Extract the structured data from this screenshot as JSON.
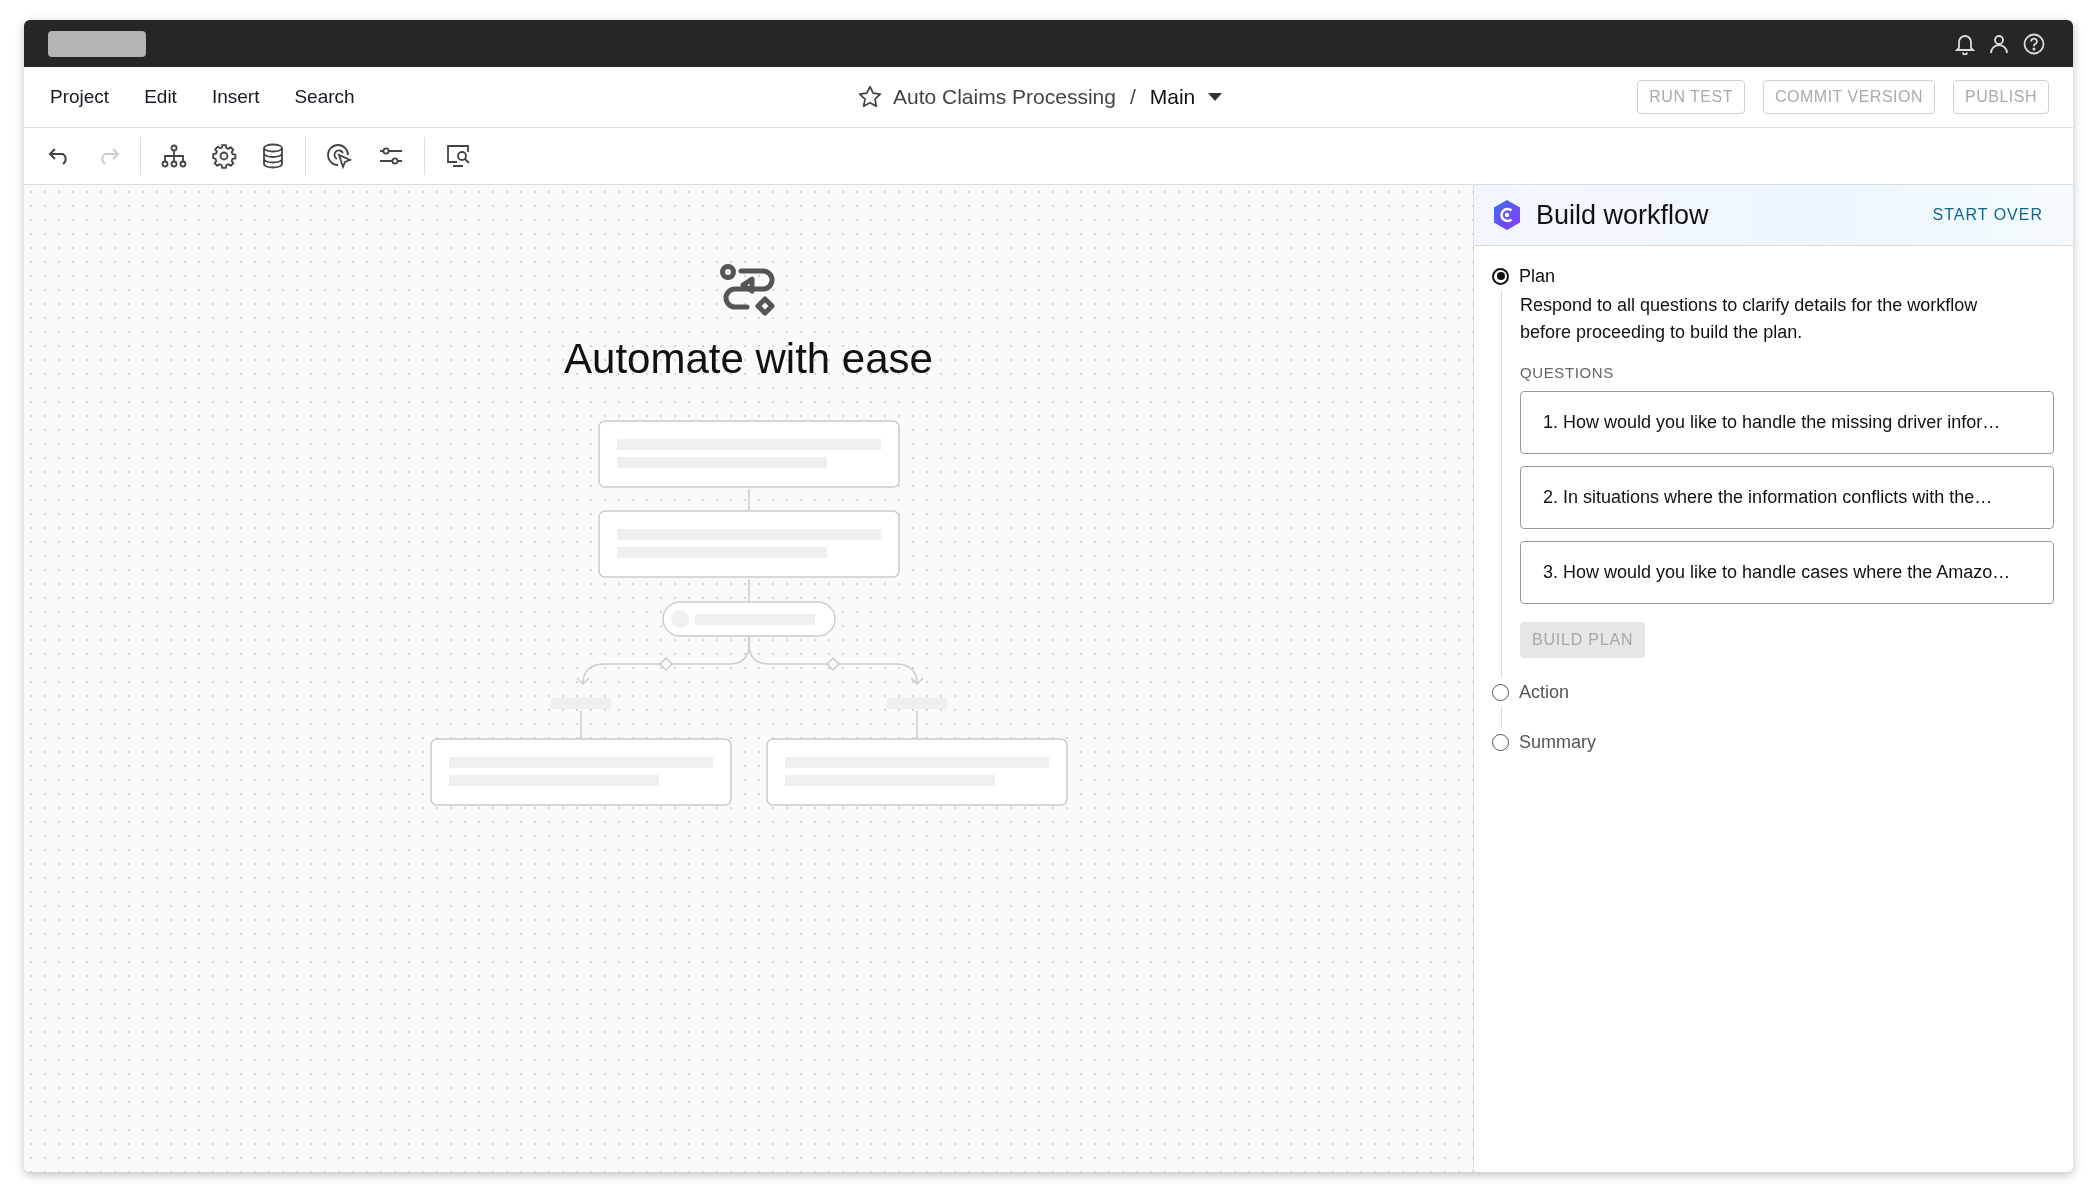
{
  "menu": [
    {
      "label": "Project"
    },
    {
      "label": "Edit"
    },
    {
      "label": "Insert"
    },
    {
      "label": "Search"
    }
  ],
  "breadcrumb": {
    "project": "Auto Claims Processing",
    "separator": "/",
    "branch": "Main"
  },
  "actions": [
    {
      "label": "RUN TEST",
      "disabled": true
    },
    {
      "label": "COMMIT VERSION",
      "disabled": true
    },
    {
      "label": "PUBLISH",
      "disabled": true
    }
  ],
  "toolbar": {
    "undo": {
      "disabled": false
    },
    "redo": {
      "disabled": true
    }
  },
  "canvas": {
    "heading": "Automate with ease"
  },
  "panel": {
    "title": "Build workflow",
    "start_over": "START OVER",
    "steps": [
      {
        "label": "Plan",
        "selected": true,
        "description": "Respond to all questions to clarify details for the workflow before proceeding to build the plan.",
        "questions_label": "QUESTIONS",
        "questions": [
          "1. How would you like to handle the missing driver infor…",
          "2. In situations where the information conflicts with the…",
          "3. How would you like to handle cases where the Amazo…"
        ],
        "button": {
          "label": "BUILD PLAN",
          "disabled": true
        }
      },
      {
        "label": "Action",
        "selected": false
      },
      {
        "label": "Summary",
        "selected": false
      }
    ]
  }
}
